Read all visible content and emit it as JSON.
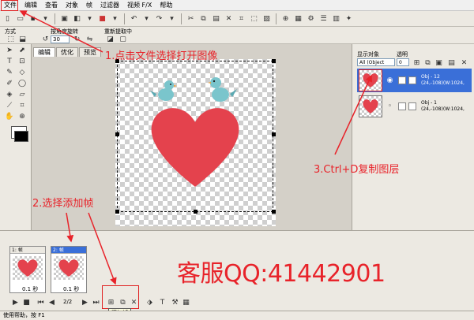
{
  "menu": [
    "文件",
    "编辑",
    "查看",
    "对象",
    "帧",
    "过滤器",
    "视频 F/X",
    "帮助"
  ],
  "toolbar2": {
    "mode_label": "方式",
    "rotate_label": "按角度旋转",
    "rotate_value": "30",
    "resample_label": "重新提取中"
  },
  "tabs": [
    "编辑",
    "优化",
    "预览"
  ],
  "right_panel": {
    "display_label": "显示对象",
    "alpha_label": "透明",
    "filter_value": "All (Object",
    "alpha_value": "0",
    "layers": [
      {
        "name": "Obj - 12",
        "info": "(24,-108)(W:1024,"
      },
      {
        "name": "Obj - 1",
        "info": "(24,-108)(W:1024,"
      }
    ]
  },
  "frames": [
    {
      "label": "1: 帧",
      "time": "0.1 秒"
    },
    {
      "label": "2: 帧",
      "time": "0.1 秒"
    }
  ],
  "playback": {
    "counter": "2/2"
  },
  "tooltip": "添加帧",
  "status": "使用帮助，按 F1",
  "annotations": {
    "step1": "1.点击文件选择打开图像",
    "step2": "2.选择添加帧",
    "step3": "3.Ctrl+D复制图层",
    "qq": "客服QQ:41442901"
  },
  "colors": {
    "heart": "#e4424d",
    "bird": "#7ac5cc",
    "annotation": "#e8232a",
    "selection": "#3a6fd8"
  }
}
